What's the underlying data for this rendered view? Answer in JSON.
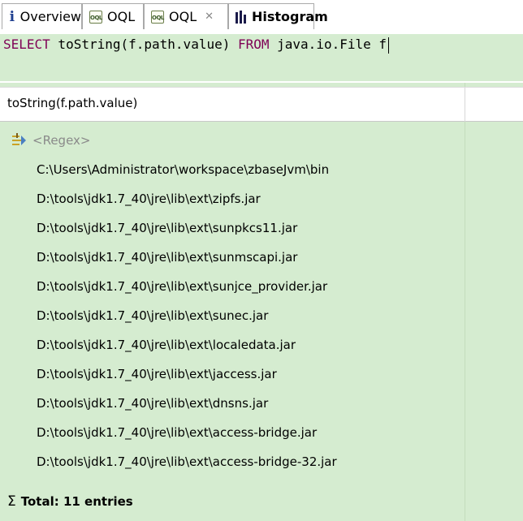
{
  "tabs": [
    {
      "label": "Overview",
      "icon": "info-icon",
      "active": false
    },
    {
      "label": "OQL",
      "icon": "oql-icon",
      "active": false
    },
    {
      "label": "OQL",
      "icon": "oql-icon",
      "active": true,
      "close": "✕"
    },
    {
      "label": "Histogram",
      "icon": "histogram-icon",
      "active": false
    }
  ],
  "query": {
    "kw_select": "SELECT",
    "expr": " toString(f.path.value) ",
    "kw_from": "FROM",
    "rest": " java.io.File f"
  },
  "table": {
    "column_header": "toString(f.path.value)",
    "regex_placeholder": "<Regex>",
    "rows": [
      "C:\\Users\\Administrator\\workspace\\zbaseJvm\\bin",
      "D:\\tools\\jdk1.7_40\\jre\\lib\\ext\\zipfs.jar",
      "D:\\tools\\jdk1.7_40\\jre\\lib\\ext\\sunpkcs11.jar",
      "D:\\tools\\jdk1.7_40\\jre\\lib\\ext\\sunmscapi.jar",
      "D:\\tools\\jdk1.7_40\\jre\\lib\\ext\\sunjce_provider.jar",
      "D:\\tools\\jdk1.7_40\\jre\\lib\\ext\\sunec.jar",
      "D:\\tools\\jdk1.7_40\\jre\\lib\\ext\\localedata.jar",
      "D:\\tools\\jdk1.7_40\\jre\\lib\\ext\\jaccess.jar",
      "D:\\tools\\jdk1.7_40\\jre\\lib\\ext\\dnsns.jar",
      "D:\\tools\\jdk1.7_40\\jre\\lib\\ext\\access-bridge.jar",
      "D:\\tools\\jdk1.7_40\\jre\\lib\\ext\\access-bridge-32.jar"
    ],
    "total_sigma": "Σ",
    "total_label": "Total: 11 entries"
  },
  "colors": {
    "result_background": "#d5ecd0",
    "keyword": "#7f0055"
  }
}
